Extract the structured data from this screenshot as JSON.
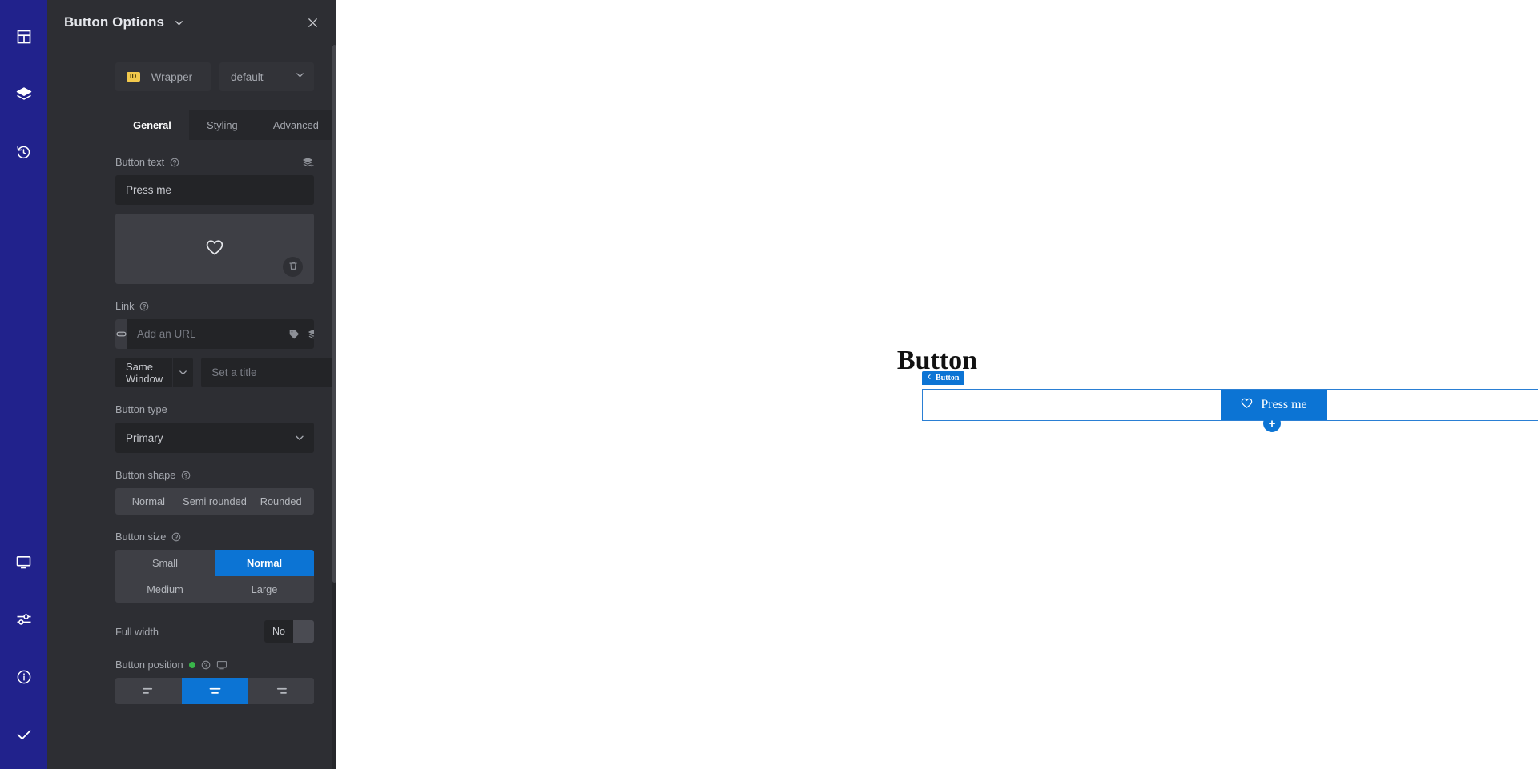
{
  "rail": {
    "top_items": [
      {
        "name": "elements-grid-icon",
        "label": "Elements"
      },
      {
        "name": "layers-icon",
        "label": "Navigator"
      },
      {
        "name": "history-icon",
        "label": "History"
      }
    ],
    "bottom_items": [
      {
        "name": "responsive-monitor-icon",
        "label": "Responsive Mode"
      },
      {
        "name": "sliders-settings-icon",
        "label": "Settings"
      },
      {
        "name": "info-circle-icon",
        "label": "Help"
      },
      {
        "name": "check-publish-icon",
        "label": "Publish"
      }
    ]
  },
  "panel": {
    "title": "Button Options",
    "title_caret": "chevron-down-icon",
    "close_icon": "close-icon",
    "id_row": {
      "badge": "ID",
      "value": "Wrapper",
      "select_value": "default"
    },
    "tabs": [
      {
        "label": "General",
        "active": true
      },
      {
        "label": "Styling",
        "active": false
      },
      {
        "label": "Advanced",
        "active": false
      }
    ],
    "search_tab_icon": "search-icon",
    "button_text": {
      "label": "Button text",
      "value": "Press me",
      "dynamic_icon": "dynamic-tags-icon",
      "help_icon": "help-circle-icon"
    },
    "icon_preview": {
      "icon": "heart-outline-icon",
      "delete_icon": "trash-icon"
    },
    "link": {
      "label": "Link",
      "help_icon": "help-circle-icon",
      "prefix_icon": "link-chain-icon",
      "placeholder": "Add an URL",
      "value": "",
      "tag_icon": "tag-icon",
      "dynamic_icon": "dynamic-tags-icon",
      "target_value": "Same Window",
      "title_placeholder": "Set a title",
      "title_value": ""
    },
    "button_type": {
      "label": "Button type",
      "value": "Primary"
    },
    "button_shape": {
      "label": "Button shape",
      "help_icon": "help-circle-icon",
      "options": [
        {
          "label": "Normal",
          "active": false
        },
        {
          "label": "Semi rounded",
          "active": false
        },
        {
          "label": "Rounded",
          "active": false
        }
      ]
    },
    "button_size": {
      "label": "Button size",
      "help_icon": "help-circle-icon",
      "options": [
        {
          "label": "Small",
          "active": false
        },
        {
          "label": "Normal",
          "active": true
        },
        {
          "label": "Medium",
          "active": false
        },
        {
          "label": "Large",
          "active": false
        }
      ]
    },
    "full_width": {
      "label": "Full width",
      "value": "No"
    },
    "button_position": {
      "label": "Button position",
      "help_icon": "help-circle-icon",
      "device_icon": "monitor-icon",
      "has_change_indicator": true,
      "options": [
        {
          "name": "align-left-icon",
          "active": false
        },
        {
          "name": "align-center-icon",
          "active": true
        },
        {
          "name": "align-right-icon",
          "active": false
        }
      ]
    }
  },
  "canvas": {
    "heading": "Button",
    "widget_badge": "Button",
    "widget_badge_caret": "chevron-left-icon",
    "preview_button": {
      "icon": "heart-outline-icon",
      "label": "Press me"
    },
    "add_button": "+"
  },
  "colors": {
    "rail_bg": "#21228C",
    "panel_bg": "#2D2E33",
    "panel_header_bg": "#2D2E33",
    "accent_blue": "#0C74D4",
    "id_badge_yellow": "#F2C94C",
    "indicator_green": "#39B54A",
    "canvas_bg": "#FFFFFF"
  }
}
